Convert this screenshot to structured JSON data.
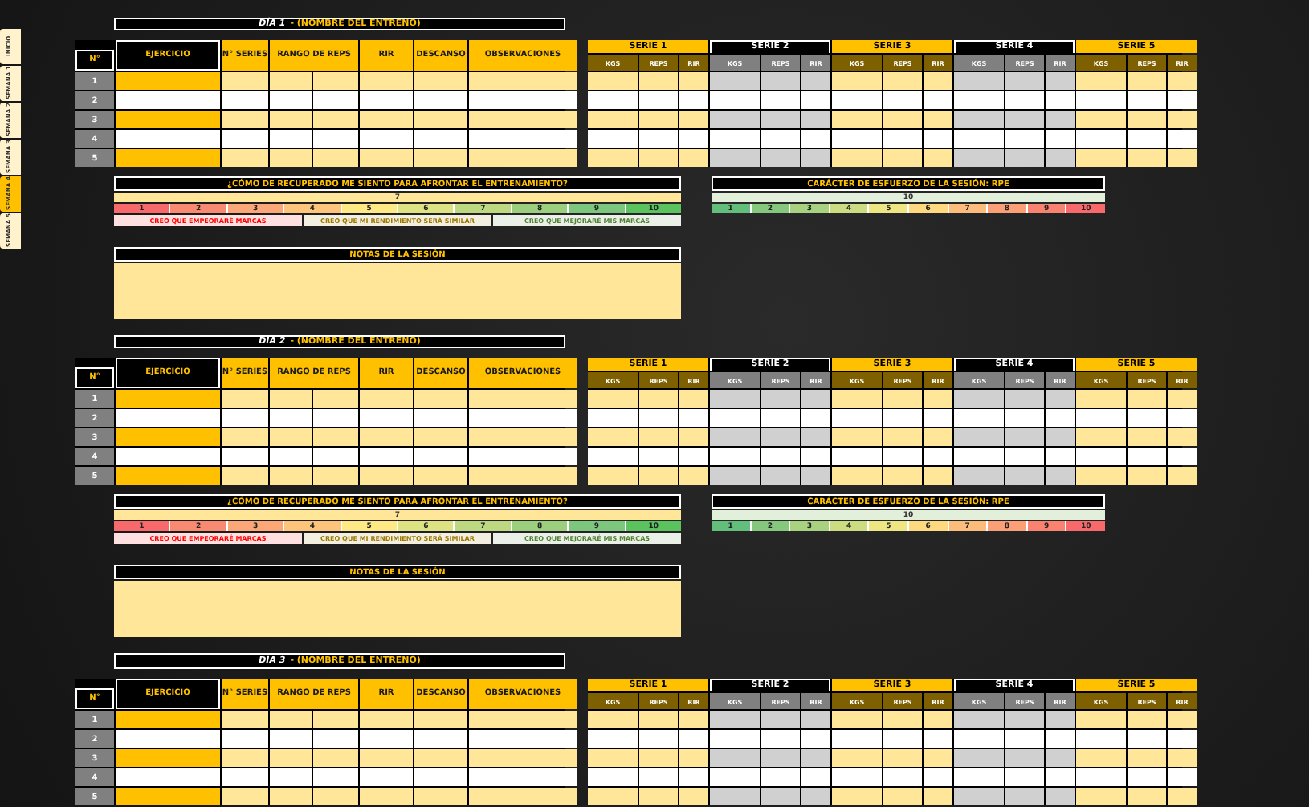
{
  "side_tabs": [
    {
      "label": "INICIO",
      "selected": false
    },
    {
      "label": "SEMANA 1",
      "selected": false
    },
    {
      "label": "SEMANA 2",
      "selected": false
    },
    {
      "label": "SEMANA 3",
      "selected": false
    },
    {
      "label": "SEMANA 4",
      "selected": true
    },
    {
      "label": "SEMANA 5",
      "selected": false
    }
  ],
  "days": [
    {
      "label": "DÍA 1",
      "name": "- (NOMBRE DEL ENTRENO)",
      "columns": [
        "N°",
        "EJERCICIO",
        "N° SERIES",
        "RANGO DE REPS",
        "RIR",
        "DESCANSO",
        "OBSERVACIONES"
      ],
      "rows": [
        "1",
        "2",
        "3",
        "4",
        "5"
      ],
      "series": [
        {
          "name": "SERIE 1",
          "kind": "gold",
          "columns": [
            "KGS",
            "REPS",
            "RIR"
          ]
        },
        {
          "name": "SERIE 2",
          "kind": "gray",
          "columns": [
            "KGS",
            "REPS",
            "RIR"
          ]
        },
        {
          "name": "SERIE 3",
          "kind": "gold",
          "columns": [
            "KGS",
            "REPS",
            "RIR"
          ]
        },
        {
          "name": "SERIE 4",
          "kind": "gray",
          "columns": [
            "KGS",
            "REPS",
            "RIR"
          ]
        },
        {
          "name": "SERIE 5",
          "kind": "gold",
          "columns": [
            "KGS",
            "REPS",
            "RIR"
          ]
        }
      ],
      "recovery": {
        "title": "¿CÓMO DE RECUPERADO ME SIENTO PARA AFRONTAR EL ENTRENAMIENTO?",
        "value": "7",
        "scale": [
          {
            "label": "1",
            "color": "#f8696b"
          },
          {
            "label": "2",
            "color": "#f98a72"
          },
          {
            "label": "3",
            "color": "#fba777"
          },
          {
            "label": "4",
            "color": "#fdc47c"
          },
          {
            "label": "5",
            "color": "#ffe984"
          },
          {
            "label": "6",
            "color": "#dde283"
          },
          {
            "label": "7",
            "color": "#bcd881"
          },
          {
            "label": "8",
            "color": "#9bcf7e"
          },
          {
            "label": "9",
            "color": "#7cc67d"
          },
          {
            "label": "10",
            "color": "#5ac35e"
          }
        ],
        "notes": [
          {
            "text": "CREO QUE EMPEORARÉ MARCAS",
            "color": "#ff0000"
          },
          {
            "text": "CREO QUE MI RENDIMIENTO SERÁ SIMILAR",
            "color": "#9c7a00"
          },
          {
            "text": "CREO QUE MEJORARÉ MIS MARCAS",
            "color": "#548235"
          }
        ]
      },
      "rpe": {
        "title": "CARÁCTER DE ESFUERZO DE LA SESIÓN: RPE",
        "value": "10",
        "scale": [
          {
            "label": "1",
            "color": "#63be7b"
          },
          {
            "label": "2",
            "color": "#85c77d"
          },
          {
            "label": "3",
            "color": "#a8d27f"
          },
          {
            "label": "4",
            "color": "#cbdc81"
          },
          {
            "label": "5",
            "color": "#ede683"
          },
          {
            "label": "6",
            "color": "#fed980"
          },
          {
            "label": "7",
            "color": "#fcbc7b"
          },
          {
            "label": "8",
            "color": "#fba076"
          },
          {
            "label": "9",
            "color": "#f98370"
          },
          {
            "label": "10",
            "color": "#f8696b"
          }
        ]
      },
      "notes_panel": {
        "title": "NOTAS DE LA SESIÓN"
      }
    },
    {
      "label": "DÍA 2",
      "name": "- (NOMBRE DEL ENTRENO)",
      "columns": [
        "N°",
        "EJERCICIO",
        "N° SERIES",
        "RANGO DE REPS",
        "RIR",
        "DESCANSO",
        "OBSERVACIONES"
      ],
      "rows": [
        "1",
        "2",
        "3",
        "4",
        "5"
      ],
      "series": [
        {
          "name": "SERIE 1",
          "kind": "gold",
          "columns": [
            "KGS",
            "REPS",
            "RIR"
          ]
        },
        {
          "name": "SERIE 2",
          "kind": "gray",
          "columns": [
            "KGS",
            "REPS",
            "RIR"
          ]
        },
        {
          "name": "SERIE 3",
          "kind": "gold",
          "columns": [
            "KGS",
            "REPS",
            "RIR"
          ]
        },
        {
          "name": "SERIE 4",
          "kind": "gray",
          "columns": [
            "KGS",
            "REPS",
            "RIR"
          ]
        },
        {
          "name": "SERIE 5",
          "kind": "gold",
          "columns": [
            "KGS",
            "REPS",
            "RIR"
          ]
        }
      ],
      "recovery": {
        "title": "¿CÓMO DE RECUPERADO ME SIENTO PARA AFRONTAR EL ENTRENAMIENTO?",
        "value": "7",
        "scale": [
          {
            "label": "1",
            "color": "#f8696b"
          },
          {
            "label": "2",
            "color": "#f98a72"
          },
          {
            "label": "3",
            "color": "#fba777"
          },
          {
            "label": "4",
            "color": "#fdc47c"
          },
          {
            "label": "5",
            "color": "#ffe984"
          },
          {
            "label": "6",
            "color": "#dde283"
          },
          {
            "label": "7",
            "color": "#bcd881"
          },
          {
            "label": "8",
            "color": "#9bcf7e"
          },
          {
            "label": "9",
            "color": "#7cc67d"
          },
          {
            "label": "10",
            "color": "#5ac35e"
          }
        ],
        "notes": [
          {
            "text": "CREO QUE EMPEORARÉ MARCAS",
            "color": "#ff0000"
          },
          {
            "text": "CREO QUE MI RENDIMIENTO SERÁ SIMILAR",
            "color": "#9c7a00"
          },
          {
            "text": "CREO QUE MEJORARÉ MIS MARCAS",
            "color": "#548235"
          }
        ]
      },
      "rpe": {
        "title": "CARÁCTER DE ESFUERZO DE LA SESIÓN: RPE",
        "value": "10",
        "scale": [
          {
            "label": "1",
            "color": "#63be7b"
          },
          {
            "label": "2",
            "color": "#85c77d"
          },
          {
            "label": "3",
            "color": "#a8d27f"
          },
          {
            "label": "4",
            "color": "#cbdc81"
          },
          {
            "label": "5",
            "color": "#ede683"
          },
          {
            "label": "6",
            "color": "#fed980"
          },
          {
            "label": "7",
            "color": "#fcbc7b"
          },
          {
            "label": "8",
            "color": "#fba076"
          },
          {
            "label": "9",
            "color": "#f98370"
          },
          {
            "label": "10",
            "color": "#f8696b"
          }
        ]
      },
      "notes_panel": {
        "title": "NOTAS DE LA SESIÓN"
      }
    },
    {
      "label": "DÍA 3",
      "name": "- (NOMBRE DEL ENTRENO)",
      "columns": [
        "N°",
        "EJERCICIO",
        "N° SERIES",
        "RANGO DE REPS",
        "RIR",
        "DESCANSO",
        "OBSERVACIONES"
      ],
      "rows": [
        "1",
        "2",
        "3",
        "4",
        "5"
      ],
      "series": [
        {
          "name": "SERIE 1",
          "kind": "gold",
          "columns": [
            "KGS",
            "REPS",
            "RIR"
          ]
        },
        {
          "name": "SERIE 2",
          "kind": "gray",
          "columns": [
            "KGS",
            "REPS",
            "RIR"
          ]
        },
        {
          "name": "SERIE 3",
          "kind": "gold",
          "columns": [
            "KGS",
            "REPS",
            "RIR"
          ]
        },
        {
          "name": "SERIE 4",
          "kind": "gray",
          "columns": [
            "KGS",
            "REPS",
            "RIR"
          ]
        },
        {
          "name": "SERIE 5",
          "kind": "gold",
          "columns": [
            "KGS",
            "REPS",
            "RIR"
          ]
        }
      ]
    }
  ]
}
